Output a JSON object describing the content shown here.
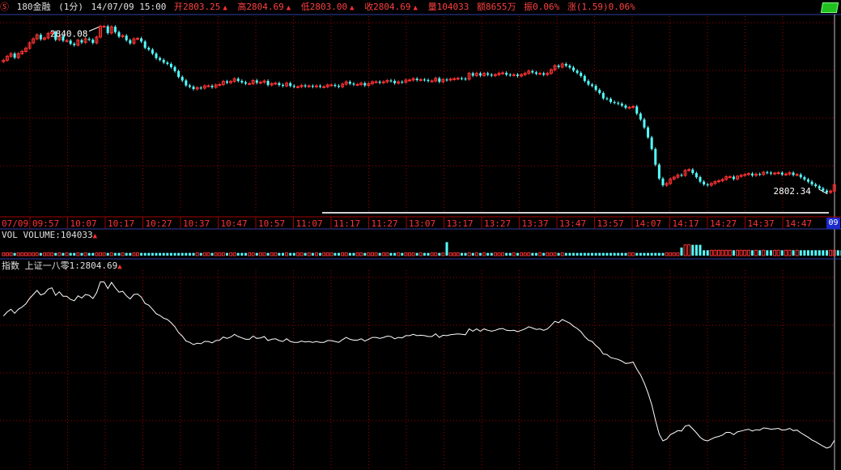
{
  "header": {
    "symbol_icon": "yen-icon",
    "name": "180金融",
    "period": "(1分)",
    "datetime": "14/07/09 15:00",
    "open_label": "开2803.25",
    "high_label": "高2804.69",
    "low_label": "低2803.00",
    "close_label": "收2804.69",
    "volume_label": "量104033",
    "amount_label": "额8655万",
    "amplitude_label": "振0.06%",
    "change_label": "涨(1.59)0.06%"
  },
  "volume_panel": {
    "label": "VOL VOLUME:104033"
  },
  "index_panel": {
    "label": "指数 上证一八零1:2804.69"
  },
  "corner_label": "09",
  "colors": {
    "up": "#ff3232",
    "down": "#54ffff",
    "grid": "#a00000",
    "axis": "#b0b0b0",
    "line": "#ffffff"
  },
  "chart_data": {
    "type": "candlestick",
    "date_label": "07/09",
    "time_ticks": [
      "09:57",
      "10:07",
      "10:17",
      "10:27",
      "10:37",
      "10:47",
      "10:57",
      "11:07",
      "11:17",
      "11:27",
      "13:07",
      "13:17",
      "13:27",
      "13:37",
      "13:47",
      "13:57",
      "14:07",
      "14:17",
      "14:27",
      "14:37",
      "14:47"
    ],
    "annotations": {
      "max": "2840.08",
      "min": "2802.34"
    },
    "price_range": [
      2799,
      2842
    ],
    "closes": [
      2832.5,
      2833.4,
      2834.0,
      2833.1,
      2834.0,
      2834.5,
      2835.2,
      2836.4,
      2837.3,
      2838.2,
      2837.2,
      2837.5,
      2838.5,
      2838.8,
      2837.1,
      2837.9,
      2836.9,
      2836.9,
      2836.2,
      2835.9,
      2837.0,
      2836.5,
      2837.3,
      2837.1,
      2836.4,
      2837.7,
      2840.1,
      2840.1,
      2838.6,
      2840.0,
      2838.8,
      2837.8,
      2838.0,
      2837.0,
      2836.3,
      2837.3,
      2837.4,
      2836.7,
      2835.3,
      2834.9,
      2834.0,
      2833.0,
      2832.6,
      2832.0,
      2831.7,
      2831.0,
      2830.1,
      2828.8,
      2828.0,
      2826.9,
      2826.6,
      2826.1,
      2826.4,
      2826.3,
      2826.8,
      2826.8,
      2826.5,
      2827.0,
      2827.1,
      2827.8,
      2827.5,
      2827.8,
      2828.4,
      2827.9,
      2827.6,
      2827.3,
      2827.3,
      2828.0,
      2827.5,
      2827.6,
      2827.9,
      2827.0,
      2827.3,
      2827.4,
      2827.0,
      2826.8,
      2827.4,
      2826.8,
      2826.6,
      2826.6,
      2826.9,
      2826.7,
      2826.8,
      2826.6,
      2826.8,
      2826.6,
      2826.6,
      2827.0,
      2827.0,
      2826.8,
      2826.6,
      2827.2,
      2827.7,
      2827.3,
      2827.1,
      2827.1,
      2827.4,
      2826.9,
      2827.3,
      2827.7,
      2827.7,
      2827.5,
      2827.7,
      2828.0,
      2827.9,
      2827.4,
      2827.7,
      2827.6,
      2828.1,
      2828.1,
      2828.4,
      2828.1,
      2828.2,
      2828.1,
      2827.9,
      2827.9,
      2828.5,
      2827.7,
      2828.2,
      2828.1,
      2828.3,
      2828.4,
      2828.5,
      2828.4,
      2828.3,
      2829.6,
      2829.1,
      2829.6,
      2829.1,
      2829.6,
      2829.3,
      2829.1,
      2829.3,
      2829.6,
      2829.7,
      2829.3,
      2829.2,
      2829.3,
      2829.0,
      2829.3,
      2829.6,
      2830.1,
      2829.8,
      2829.5,
      2829.6,
      2829.3,
      2829.6,
      2830.4,
      2831.3,
      2831.0,
      2831.7,
      2831.3,
      2830.9,
      2830.2,
      2829.7,
      2829.0,
      2827.9,
      2827.1,
      2826.8,
      2825.9,
      2825.2,
      2824.0,
      2823.9,
      2823.2,
      2823.0,
      2822.8,
      2822.4,
      2821.9,
      2822.0,
      2822.2,
      2820.6,
      2819.3,
      2817.5,
      2815.3,
      2812.7,
      2809.2,
      2806.1,
      2804.6,
      2805.0,
      2806.0,
      2806.4,
      2806.9,
      2806.8,
      2807.9,
      2808.1,
      2807.3,
      2806.4,
      2805.4,
      2804.8,
      2804.6,
      2805.0,
      2805.4,
      2805.6,
      2805.9,
      2806.5,
      2806.5,
      2806.0,
      2806.6,
      2806.8,
      2807.0,
      2807.2,
      2806.8,
      2807.1,
      2807.0,
      2807.5,
      2807.4,
      2807.2,
      2807.3,
      2807.4,
      2807.0,
      2807.1,
      2807.4,
      2806.9,
      2807.0,
      2806.4,
      2805.9,
      2805.4,
      2804.8,
      2804.4,
      2803.9,
      2803.4,
      2803.0,
      2803.3,
      2804.69
    ],
    "volume_max": 6,
    "volumes": [
      1,
      1,
      1,
      1,
      1,
      1,
      1,
      1,
      1,
      1,
      1,
      1,
      1,
      1,
      1,
      1,
      1,
      1,
      1,
      1,
      1,
      1,
      1,
      1,
      1,
      1,
      1,
      1,
      1,
      1,
      1,
      1,
      1,
      1,
      1,
      1,
      1,
      1,
      1,
      1,
      1,
      1,
      1,
      1,
      1,
      1,
      1,
      1,
      1,
      1,
      1,
      1,
      1,
      1,
      1,
      1,
      1,
      1,
      1,
      1,
      1,
      1,
      1,
      1,
      1,
      1,
      1,
      1,
      1,
      1,
      1,
      1,
      1,
      1,
      1,
      1,
      1,
      1,
      1,
      1,
      1,
      1,
      1,
      1,
      1,
      1,
      1,
      1,
      1,
      1,
      1,
      1,
      1,
      1,
      1,
      1,
      1,
      1,
      1,
      1,
      1,
      1,
      1,
      1,
      1,
      1,
      1,
      1,
      1,
      1,
      1,
      1,
      1,
      1,
      1,
      1,
      1,
      1,
      1,
      5,
      1,
      1,
      1,
      1,
      1,
      1,
      1,
      1,
      1,
      1,
      1,
      1,
      1,
      1,
      1,
      1,
      1,
      1,
      1,
      1,
      1,
      1,
      1,
      1,
      1,
      1,
      1,
      1,
      1,
      1,
      1,
      1,
      1,
      1,
      1,
      1,
      1,
      1,
      1,
      1,
      1,
      1,
      1,
      1,
      1,
      1,
      1,
      1,
      1,
      1,
      1,
      1,
      1,
      1,
      1,
      1,
      1,
      1,
      1,
      1,
      1,
      1,
      3,
      4,
      4,
      4,
      4,
      4,
      2,
      2,
      2,
      2,
      2,
      2,
      2,
      2,
      2,
      2,
      2,
      2,
      2,
      2,
      2,
      2,
      2,
      2,
      2,
      2,
      2,
      2,
      2,
      2,
      2,
      2,
      2,
      2,
      2,
      2,
      2,
      2,
      2,
      2,
      2,
      2,
      2,
      2,
      2,
      2,
      2,
      2,
      2,
      3
    ]
  }
}
